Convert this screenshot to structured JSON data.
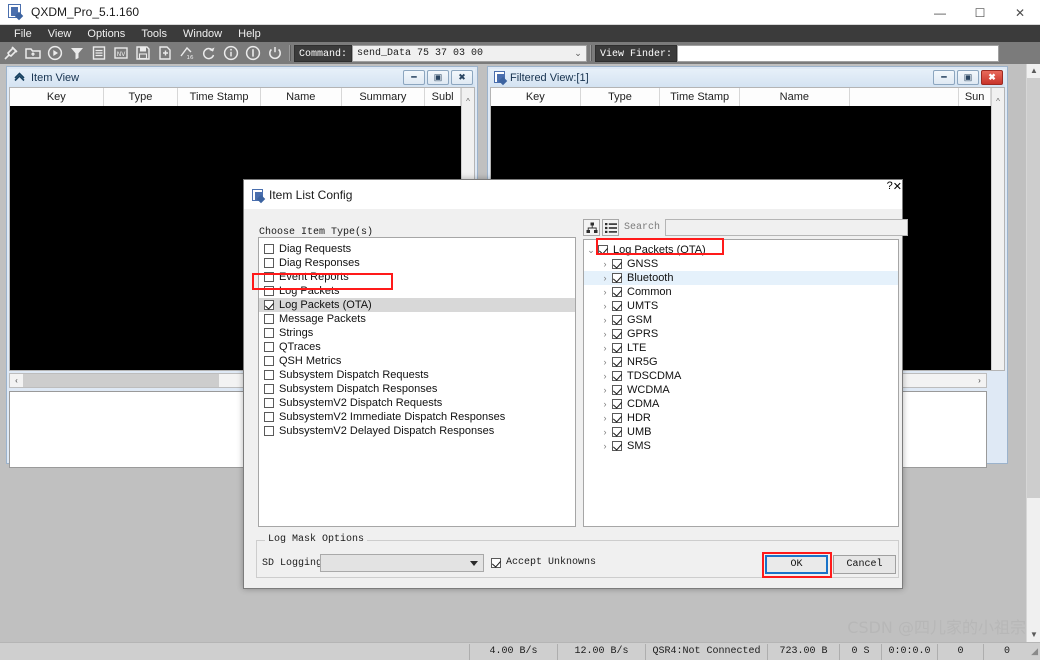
{
  "window": {
    "title": "QXDM_Pro_5.1.160",
    "icon": "qxdm-app-icon",
    "minimize": "—",
    "maximize": "☐",
    "close": "✕"
  },
  "menubar": {
    "items": [
      "File",
      "View",
      "Options",
      "Tools",
      "Window",
      "Help"
    ]
  },
  "toolbar": {
    "icons": [
      "connect-plug-icon",
      "open-folder-icon",
      "play-icon",
      "filter-icon",
      "log-list-icon",
      "nv-browser-icon",
      "save-icon",
      "new-item-icon",
      "hex-converter-icon",
      "refresh-icon",
      "info-icon",
      "alert-icon",
      "power-icon"
    ],
    "command_label": "Command:",
    "command_value": "send_Data 75 37 03 00",
    "command_placeholder": "",
    "viewfinder_label": "View Finder:",
    "viewfinder_value": "",
    "viewfinder_placeholder": ""
  },
  "item_view": {
    "title": "Item View",
    "icon": "collapse-chevron-icon",
    "buttons": {
      "minimize": "━",
      "restore": "▣",
      "close": "✖"
    },
    "columns": [
      "Key",
      "Type",
      "Time Stamp",
      "Name",
      "Summary",
      "Subl"
    ],
    "rows": [],
    "hscroll_left_arrow": "‹"
  },
  "filtered_view": {
    "title": "Filtered View:[1]",
    "icon": "qxdm-window-icon",
    "buttons": {
      "minimize": "━",
      "restore": "▣",
      "close": "✖"
    },
    "columns": [
      "Key",
      "Type",
      "Time Stamp",
      "Name",
      "",
      "Sun"
    ],
    "rows": [],
    "hscroll_right_arrow": "›"
  },
  "dialog": {
    "title": "Item List Config",
    "icon": "qxdm-window-icon",
    "help_button": "?",
    "close_button": "✕",
    "choose_label": "Choose Item Type(s)",
    "item_types": [
      {
        "label": "Diag Requests",
        "checked": false,
        "selected": false
      },
      {
        "label": "Diag Responses",
        "checked": false,
        "selected": false
      },
      {
        "label": "Event Reports",
        "checked": false,
        "selected": false
      },
      {
        "label": "Log Packets",
        "checked": false,
        "selected": false
      },
      {
        "label": "Log Packets (OTA)",
        "checked": true,
        "selected": true
      },
      {
        "label": "Message Packets",
        "checked": false,
        "selected": false
      },
      {
        "label": "Strings",
        "checked": false,
        "selected": false
      },
      {
        "label": "QTraces",
        "checked": false,
        "selected": false
      },
      {
        "label": "QSH Metrics",
        "checked": false,
        "selected": false
      },
      {
        "label": "Subsystem Dispatch Requests",
        "checked": false,
        "selected": false
      },
      {
        "label": "Subsystem Dispatch Responses",
        "checked": false,
        "selected": false
      },
      {
        "label": "SubsystemV2 Dispatch Requests",
        "checked": false,
        "selected": false
      },
      {
        "label": "SubsystemV2 Immediate Dispatch Responses",
        "checked": false,
        "selected": false
      },
      {
        "label": "SubsystemV2 Delayed Dispatch Responses",
        "checked": false,
        "selected": false
      }
    ],
    "tree_toolbar": {
      "tree_view_icon": "tree-view-icon",
      "list_view_icon": "list-view-icon",
      "search_label": "Search",
      "search_value": "",
      "search_placeholder": ""
    },
    "tree_root": {
      "label": "Log Packets (OTA)",
      "checked": true,
      "expanded": true,
      "twisty": "⌄"
    },
    "tree_children": [
      {
        "label": "GNSS",
        "checked": true,
        "highlighted": false,
        "twisty": "›"
      },
      {
        "label": "Bluetooth",
        "checked": true,
        "highlighted": true,
        "twisty": "›"
      },
      {
        "label": "Common",
        "checked": true,
        "highlighted": false,
        "twisty": "›"
      },
      {
        "label": "UMTS",
        "checked": true,
        "highlighted": false,
        "twisty": "›"
      },
      {
        "label": "GSM",
        "checked": true,
        "highlighted": false,
        "twisty": "›"
      },
      {
        "label": "GPRS",
        "checked": true,
        "highlighted": false,
        "twisty": "›"
      },
      {
        "label": "LTE",
        "checked": true,
        "highlighted": false,
        "twisty": "›"
      },
      {
        "label": "NR5G",
        "checked": true,
        "highlighted": false,
        "twisty": "›"
      },
      {
        "label": "TDSCDMA",
        "checked": true,
        "highlighted": false,
        "twisty": "›"
      },
      {
        "label": "WCDMA",
        "checked": true,
        "highlighted": false,
        "twisty": "›"
      },
      {
        "label": "CDMA",
        "checked": true,
        "highlighted": false,
        "twisty": "›"
      },
      {
        "label": "HDR",
        "checked": true,
        "highlighted": false,
        "twisty": "›"
      },
      {
        "label": "UMB",
        "checked": true,
        "highlighted": false,
        "twisty": "›"
      },
      {
        "label": "SMS",
        "checked": true,
        "highlighted": false,
        "twisty": "›"
      }
    ],
    "log_mask": {
      "legend": "Log Mask Options",
      "sd_logging_label": "SD Logging:",
      "sd_logging_value": "",
      "accept_unknowns_label": "Accept Unknowns",
      "accept_unknowns_checked": true
    },
    "ok_label": "OK",
    "cancel_label": "Cancel"
  },
  "statusbar": {
    "cells": [
      "4.00 B/s",
      "12.00 B/s",
      "QSR4:Not Connected",
      "723.00 B",
      "0 S",
      "0:0:0.0",
      "0",
      "0"
    ],
    "grip": "◢"
  },
  "watermark": "CSDN @四儿家的小祖宗",
  "colors": {
    "annotation_red": "#ff1a1a",
    "focus_blue": "#1a73c8",
    "menubar_bg": "#3b3b3b",
    "toolbar_bg": "#7b7b7b",
    "mdi_bg": "#c0c0c0",
    "selection_blue": "#e5f1fb"
  }
}
